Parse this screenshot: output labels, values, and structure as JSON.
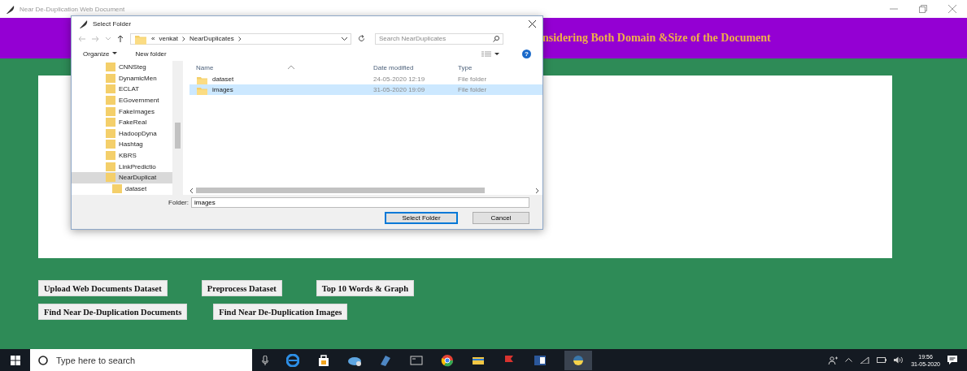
{
  "window": {
    "title": "Near De-Duplication Web Document"
  },
  "banner": {
    "title": "nsidering Both Domain &Size of the Document"
  },
  "buttons": [
    [
      "Upload Web Documents Dataset",
      "Preprocess Dataset",
      "Top 10 Words & Graph"
    ],
    [
      "Find Near De-Duplication Documents",
      "Find Near De-Duplication Images"
    ]
  ],
  "dialog": {
    "title": "Select Folder",
    "breadcrumb": [
      "«",
      "venkat",
      "NearDuplicates"
    ],
    "search": {
      "placeholder": "Search NearDuplicates"
    },
    "toolbar": {
      "organize": "Organize",
      "new_folder": "New folder",
      "help": "?"
    },
    "nav": [
      {
        "label": "CNNSteg",
        "selected": false
      },
      {
        "label": "DynamicMen",
        "selected": false
      },
      {
        "label": "ECLAT",
        "selected": false
      },
      {
        "label": "EGovernment",
        "selected": false
      },
      {
        "label": "FakeImages",
        "selected": false
      },
      {
        "label": "FakeReal",
        "selected": false
      },
      {
        "label": "HadoopDyna",
        "selected": false
      },
      {
        "label": "Hashtag",
        "selected": false
      },
      {
        "label": "KBRS",
        "selected": false
      },
      {
        "label": "LinkPredictio",
        "selected": false
      },
      {
        "label": "NearDuplicat",
        "selected": true,
        "children": [
          {
            "label": "dataset",
            "selected": false
          }
        ]
      }
    ],
    "columns": [
      "Name",
      "Date modified",
      "Type"
    ],
    "files": [
      {
        "name": "dataset",
        "date": "24-05-2020 12:19",
        "type": "File folder",
        "selected": false
      },
      {
        "name": "images",
        "date": "31-05-2020 19:09",
        "type": "File folder",
        "selected": true
      }
    ],
    "folder": {
      "label": "Folder:",
      "value": "images"
    },
    "buttons": [
      {
        "label": "Select Folder",
        "default": true
      },
      {
        "label": "Cancel",
        "default": false
      }
    ]
  },
  "taskbar": {
    "search": {
      "placeholder": "Type here to search"
    },
    "time": "19:56",
    "date": "31-05-2020"
  }
}
